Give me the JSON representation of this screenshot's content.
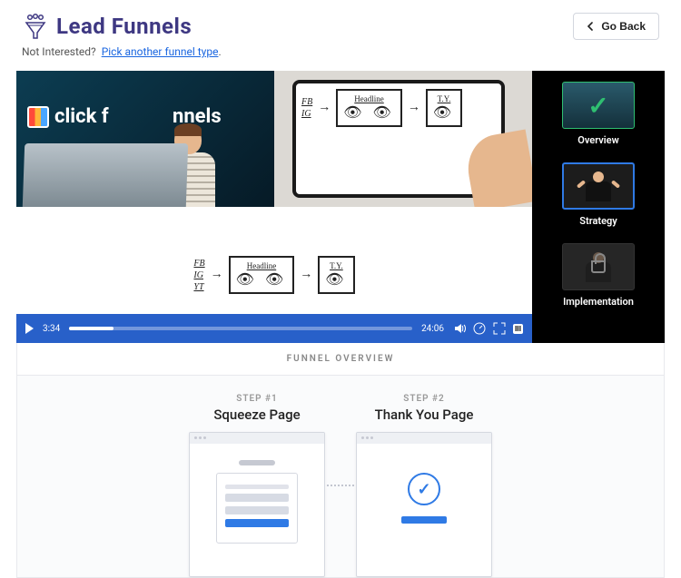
{
  "header": {
    "logo_text": "Lead Funnels",
    "goback_label": "Go Back"
  },
  "subhead": {
    "prefix": "Not Interested?",
    "link_text": "Pick another funnel type",
    "suffix": "."
  },
  "video": {
    "cf_logo_left": "click f",
    "cf_logo_right": "nnels",
    "sketch": {
      "sources": [
        "FB",
        "IG",
        "YT"
      ],
      "box1_head": "Headline",
      "box2_head": "T.Y."
    },
    "controls": {
      "current_time": "3:34",
      "total_time": "24:06",
      "progress_percent": 13,
      "badge": "III"
    }
  },
  "chapters": [
    {
      "id": "overview",
      "label": "Overview",
      "state": "done"
    },
    {
      "id": "strategy",
      "label": "Strategy",
      "state": "active"
    },
    {
      "id": "implementation",
      "label": "Implementation",
      "state": "locked"
    }
  ],
  "overview": {
    "section_title": "FUNNEL OVERVIEW",
    "steps": [
      {
        "num": "STEP #1",
        "title": "Squeeze Page",
        "kind": "squeeze"
      },
      {
        "num": "STEP #2",
        "title": "Thank You Page",
        "kind": "thankyou"
      }
    ]
  }
}
